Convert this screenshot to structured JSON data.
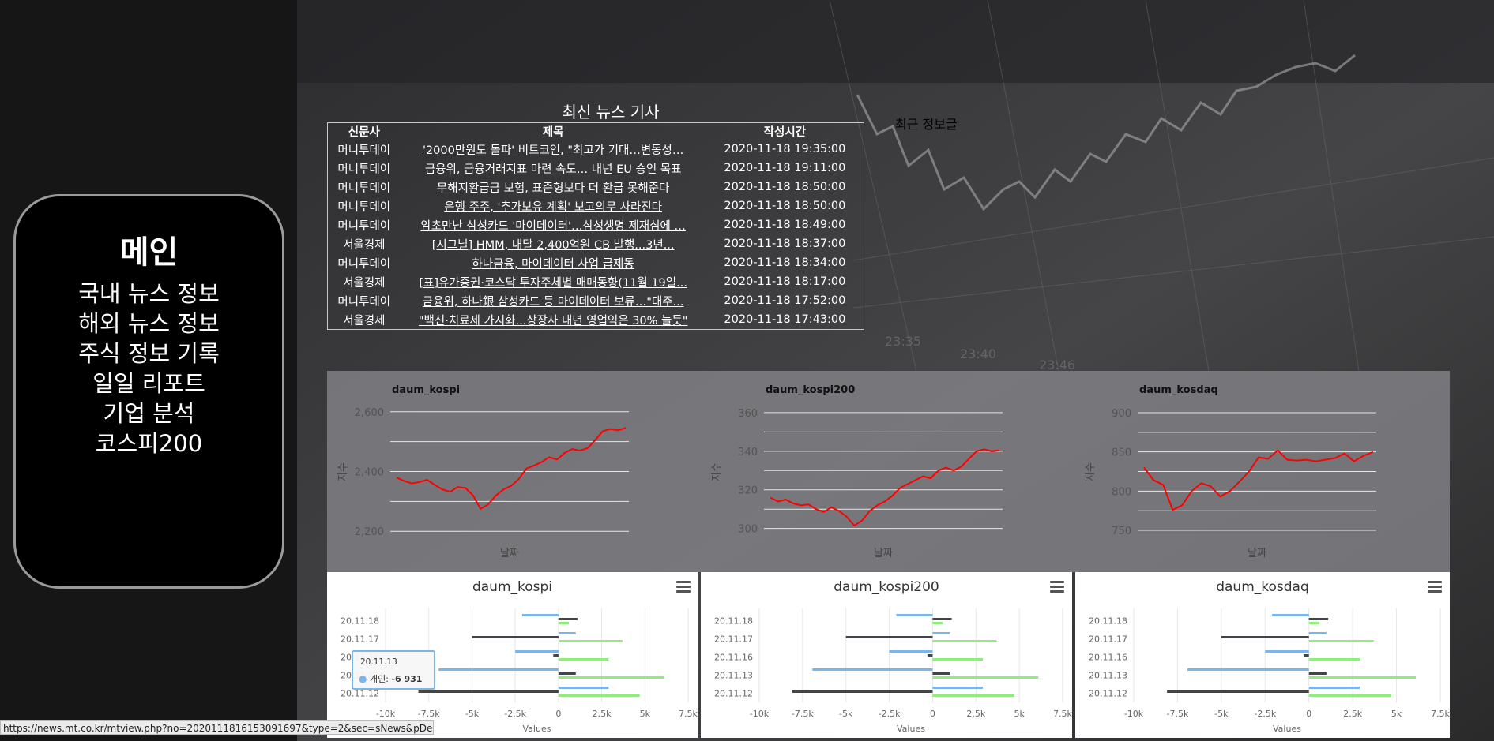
{
  "sidebar": {
    "title": "메인",
    "items": [
      "국내 뉴스 정보",
      "해외 뉴스 정보",
      "주식 정보 기록",
      "일일 리포트",
      "기업 분석",
      "코스피200"
    ]
  },
  "news": {
    "title": "최신 뉴스 기사",
    "headers": [
      "신문사",
      "제목",
      "작성시간"
    ],
    "rows": [
      [
        "머니투데이",
        "'2000만원도 돌파' 비트코인, \"최고가 기대…변동성…",
        "2020-11-18 19:35:00"
      ],
      [
        "머니투데이",
        "금융위, 금융거래지표 마련 속도… 내년 EU 승인 목표",
        "2020-11-18 19:11:00"
      ],
      [
        "머니투데이",
        "무해지환급금 보험, 표준형보다 더 환급 못해준다",
        "2020-11-18 18:50:00"
      ],
      [
        "머니투데이",
        "은행 주주, '추가보유 계획' 보고의무 사라진다",
        "2020-11-18 18:50:00"
      ],
      [
        "머니투데이",
        "암초만난 삼성카드 '마이데이터'…삼성생명 제재심에 …",
        "2020-11-18 18:49:00"
      ],
      [
        "서울경제",
        "[시그널] HMM, 내달 2,400억원 CB 발행...3년...",
        "2020-11-18 18:37:00"
      ],
      [
        "머니투데이",
        "하나금융, 마이데이터 사업 급제동",
        "2020-11-18 18:34:00"
      ],
      [
        "서울경제",
        "[표]유가증권·코스닥 투자주체별 매매동향(11월 19일...",
        "2020-11-18 18:17:00"
      ],
      [
        "머니투데이",
        "금융위, 하나銀 삼성카드 등 마이데이터 보류…\"대주...",
        "2020-11-18 17:52:00"
      ],
      [
        "서울경제",
        "\"백신·치료제 가시화...상장사 내년 영업익은 30% 늘듯\"",
        "2020-11-18 17:43:00"
      ]
    ]
  },
  "recent_label": "최근 정보글",
  "status_url": "https://news.mt.co.kr/mtview.php?no=2020111816153091697&type=2&sec=sNews&pDepth2=Ftotal",
  "tooltip": {
    "date": "20.11.13",
    "label": "개인:",
    "value": "-6 931"
  },
  "colors": {
    "line": "#ff0000",
    "bar_personal": "#7cb5ec",
    "bar_foreign": "#434348",
    "bar_institution": "#90ed7d",
    "tooltip_border": "#7cb5ec"
  },
  "icons": {
    "chart_menu": "hamburger-menu-icon",
    "tooltip_marker": "circle-marker-icon"
  },
  "chart_data": [
    {
      "type": "line",
      "title": "daum_kospi",
      "xlabel": "날짜",
      "ylabel": "지수",
      "ylim": [
        2190,
        2610
      ],
      "yticks": [
        2200,
        2300,
        2400,
        2500,
        2600
      ],
      "ytick_labels": [
        "2,200",
        "",
        "2,400",
        "",
        "2,600"
      ],
      "values": [
        2380,
        2368,
        2360,
        2365,
        2372,
        2355,
        2340,
        2332,
        2348,
        2345,
        2320,
        2275,
        2290,
        2320,
        2340,
        2352,
        2375,
        2410,
        2420,
        2432,
        2448,
        2440,
        2462,
        2475,
        2470,
        2478,
        2505,
        2535,
        2542,
        2538,
        2546
      ]
    },
    {
      "type": "line",
      "title": "daum_kospi200",
      "xlabel": "날짜",
      "ylabel": "지수",
      "ylim": [
        297,
        362
      ],
      "yticks": [
        300,
        310,
        320,
        330,
        340,
        350,
        360
      ],
      "ytick_labels": [
        "300",
        "",
        "320",
        "",
        "340",
        "",
        "360"
      ],
      "values": [
        316,
        314,
        315,
        313,
        312,
        312.5,
        310,
        308.5,
        311,
        309,
        306,
        301.5,
        304,
        309,
        312,
        314,
        317,
        321,
        323,
        325,
        327,
        326,
        330,
        331.5,
        330,
        332,
        336,
        340,
        341,
        340,
        340.5
      ]
    },
    {
      "type": "line",
      "title": "daum_kosdaq",
      "xlabel": "날짜",
      "ylabel": "지수",
      "ylim": [
        745,
        905
      ],
      "yticks": [
        750,
        775,
        800,
        825,
        850,
        875,
        900
      ],
      "ytick_labels": [
        "750",
        "",
        "800",
        "",
        "850",
        "",
        "900"
      ],
      "values": [
        830,
        814,
        808,
        776,
        782,
        800,
        810,
        806,
        793,
        800,
        812,
        825,
        843,
        841,
        852,
        840,
        839,
        840,
        838,
        840,
        842,
        848,
        838,
        845,
        850
      ]
    },
    {
      "type": "bar",
      "orientation": "horizontal",
      "title": "daum_kospi",
      "xlabel": "Values",
      "categories": [
        "20.11.18",
        "20.11.17",
        "20.11.16",
        "20.11.13",
        "20.11.12"
      ],
      "xlim": [
        -10000,
        7500
      ],
      "xticks": [
        -10000,
        -7500,
        -5000,
        -2500,
        0,
        2500,
        5000,
        7500
      ],
      "xtick_labels": [
        "-10k",
        "-7.5k",
        "-5k",
        "-2.5k",
        "0",
        "2.5k",
        "5k",
        "7.5k"
      ],
      "series": [
        {
          "values": [
            -2100,
            1000,
            -2500,
            -6931,
            2900
          ]
        },
        {
          "values": [
            1100,
            -5000,
            -300,
            1000,
            -8100
          ]
        },
        {
          "values": [
            600,
            3700,
            2900,
            6100,
            4700
          ]
        }
      ]
    },
    {
      "type": "bar",
      "orientation": "horizontal",
      "title": "daum_kospi200",
      "xlabel": "Values",
      "categories": [
        "20.11.18",
        "20.11.17",
        "20.11.16",
        "20.11.13",
        "20.11.12"
      ],
      "xlim": [
        -10000,
        7500
      ],
      "xticks": [
        -10000,
        -7500,
        -5000,
        -2500,
        0,
        2500,
        5000,
        7500
      ],
      "xtick_labels": [
        "-10k",
        "-7.5k",
        "-5k",
        "-2.5k",
        "0",
        "2.5k",
        "5k",
        "7.5k"
      ],
      "series": [
        {
          "values": [
            -2100,
            1000,
            -2500,
            -6931,
            2900
          ]
        },
        {
          "values": [
            1100,
            -5000,
            -300,
            1000,
            -8100
          ]
        },
        {
          "values": [
            600,
            3700,
            2900,
            6100,
            4700
          ]
        }
      ]
    },
    {
      "type": "bar",
      "orientation": "horizontal",
      "title": "daum_kosdaq",
      "xlabel": "Values",
      "categories": [
        "20.11.18",
        "20.11.17",
        "20.11.16",
        "20.11.13",
        "20.11.12"
      ],
      "xlim": [
        -10000,
        7500
      ],
      "xticks": [
        -10000,
        -7500,
        -5000,
        -2500,
        0,
        2500,
        5000,
        7500
      ],
      "xtick_labels": [
        "-10k",
        "-7.5k",
        "-5k",
        "-2.5k",
        "0",
        "2.5k",
        "5k",
        "7.5k"
      ],
      "series": [
        {
          "values": [
            -2100,
            1000,
            -2500,
            -6931,
            2900
          ]
        },
        {
          "values": [
            1100,
            -5000,
            -300,
            1000,
            -8100
          ]
        },
        {
          "values": [
            600,
            3700,
            2900,
            6100,
            4700
          ]
        }
      ]
    }
  ]
}
